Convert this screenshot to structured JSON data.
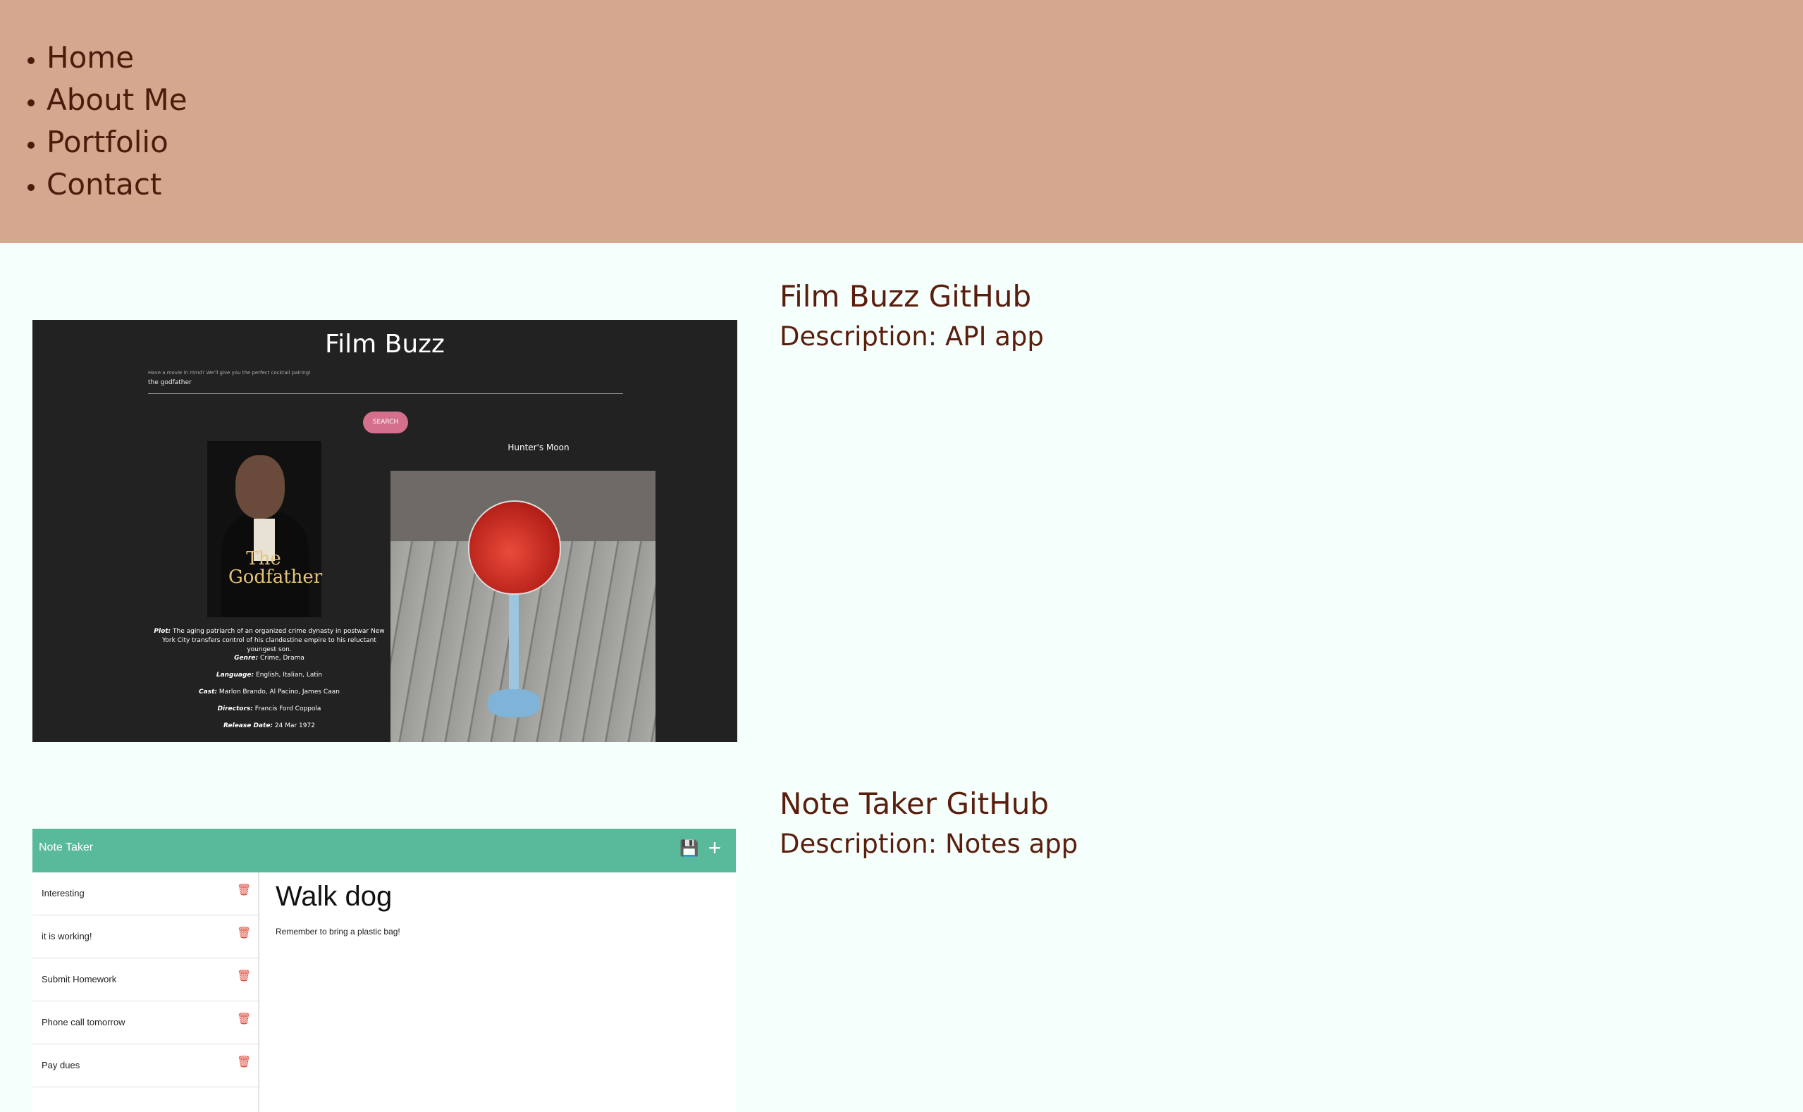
{
  "nav": {
    "items": [
      "Home",
      "About Me",
      "Portfolio",
      "Contact"
    ]
  },
  "projects": [
    {
      "title": "Film Buzz GitHub",
      "description": "Description: API app",
      "screenshot": {
        "app_title": "Film Buzz",
        "hint": "Have a movie in mind? We'll give you the perfect cocktail pairing!",
        "search_value": "the godfather",
        "search_button": "SEARCH",
        "drink_name": "Hunter's Moon",
        "poster_text": "The Godfather",
        "plot_label": "Plot:",
        "plot": "The aging patriarch of an organized crime dynasty in postwar New York City transfers control of his clandestine empire to his reluctant youngest son.",
        "genre_label": "Genre:",
        "genre": "Crime, Drama",
        "language_label": "Language:",
        "language": "English, Italian, Latin",
        "cast_label": "Cast:",
        "cast": "Marlon Brando, Al Pacino, James Caan",
        "directors_label": "Directors:",
        "directors": "Francis Ford Coppola",
        "release_label": "Release Date:",
        "release": "24 Mar 1972"
      }
    },
    {
      "title": "Note Taker GitHub",
      "description": "Description: Notes app",
      "screenshot": {
        "app_title": "Note Taker",
        "notes": [
          "Interesting",
          "it is working!",
          "Submit Homework",
          "Phone call tomorrow",
          "Pay dues"
        ],
        "active_title": "Walk dog",
        "active_text": "Remember to bring a plastic bag!"
      }
    }
  ],
  "colors": {
    "header_bg": "#d5a78e",
    "page_bg": "#f5fffc",
    "text": "#5a1e0e",
    "notetaker_accent": "#58b99b"
  }
}
